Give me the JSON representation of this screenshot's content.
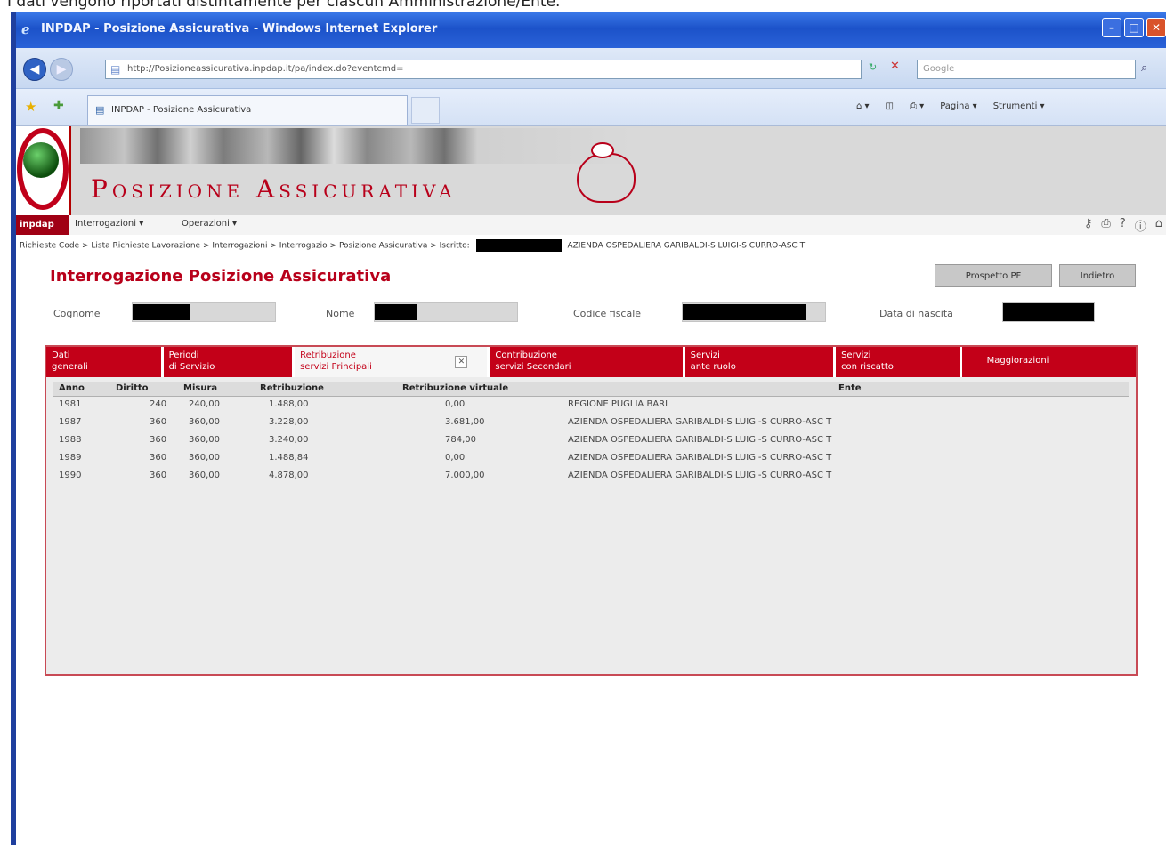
{
  "caption": "I dati vengono riportati distintamente per ciascun Amministrazione/Ente.",
  "browser": {
    "title": "INPDAP - Posizione Assicurativa - Windows Internet Explorer",
    "url": "http://Posizioneassicurativa.inpdap.it/pa/index.do?eventcmd=",
    "search_placeholder": "Google",
    "tab_title": "INPDAP - Posizione Assicurativa",
    "cmd_page": "Pagina ▾",
    "cmd_tools": "Strumenti ▾"
  },
  "app": {
    "banner_title": "Posizione Assicurativa",
    "brand": "inpdap",
    "menu": [
      "Interrogazioni ▾",
      "Operazioni ▾"
    ],
    "breadcrumb": "Richieste Code > Lista Richieste Lavorazione > Interrogazioni > Interrogazio > Posizione Assicurativa > Iscritto:",
    "breadcrumb_tail": "AZIENDA OSPEDALIERA GARIBALDI-S LUIGI-S CURRO-ASC T",
    "page_title": "Interrogazione Posizione Assicurativa",
    "buttons": {
      "pdf": "Prospetto PF",
      "back": "Indietro"
    },
    "fields": {
      "cognome_label": "Cognome",
      "nome_label": "Nome",
      "cf_label": "Codice fiscale",
      "nascita_label": "Data di nascita"
    },
    "tabs": [
      {
        "line1": "Dati",
        "line2": "generali"
      },
      {
        "line1": "Periodi",
        "line2": "di Servizio"
      },
      {
        "line1": "Retribuzione",
        "line2": "servizi Principali"
      },
      {
        "line1": "Contribuzione",
        "line2": "servizi Secondari"
      },
      {
        "line1": "Servizi",
        "line2": "ante ruolo"
      },
      {
        "line1": "Servizi",
        "line2": "con riscatto"
      },
      {
        "line1": "Maggiorazioni",
        "line2": ""
      }
    ],
    "table": {
      "headers": [
        "Anno",
        "Diritto",
        "Misura",
        "Retribuzione",
        "Retribuzione virtuale",
        "Ente"
      ],
      "rows": [
        [
          "1981",
          "240",
          "240,00",
          "1.488,00",
          "0,00",
          "REGIONE PUGLIA BARI"
        ],
        [
          "1987",
          "360",
          "360,00",
          "3.228,00",
          "3.681,00",
          "AZIENDA OSPEDALIERA GARIBALDI-S LUIGI-S CURRO-ASC T"
        ],
        [
          "1988",
          "360",
          "360,00",
          "3.240,00",
          "784,00",
          "AZIENDA OSPEDALIERA GARIBALDI-S LUIGI-S CURRO-ASC T"
        ],
        [
          "1989",
          "360",
          "360,00",
          "1.488,84",
          "0,00",
          "AZIENDA OSPEDALIERA GARIBALDI-S LUIGI-S CURRO-ASC T"
        ],
        [
          "1990",
          "360",
          "360,00",
          "4.878,00",
          "7.000,00",
          "AZIENDA OSPEDALIERA GARIBALDI-S LUIGI-S CURRO-ASC T"
        ]
      ]
    }
  },
  "icons": [
    "ie-icon",
    "back-icon",
    "forward-icon",
    "page-icon",
    "refresh-icon",
    "stop-icon",
    "search-icon",
    "favorites-star-icon",
    "add-favorites-icon",
    "home-icon",
    "feeds-icon",
    "print-icon",
    "pig-icon",
    "key-icon",
    "printer-icon",
    "help-icon",
    "info-icon",
    "home-app-icon"
  ]
}
